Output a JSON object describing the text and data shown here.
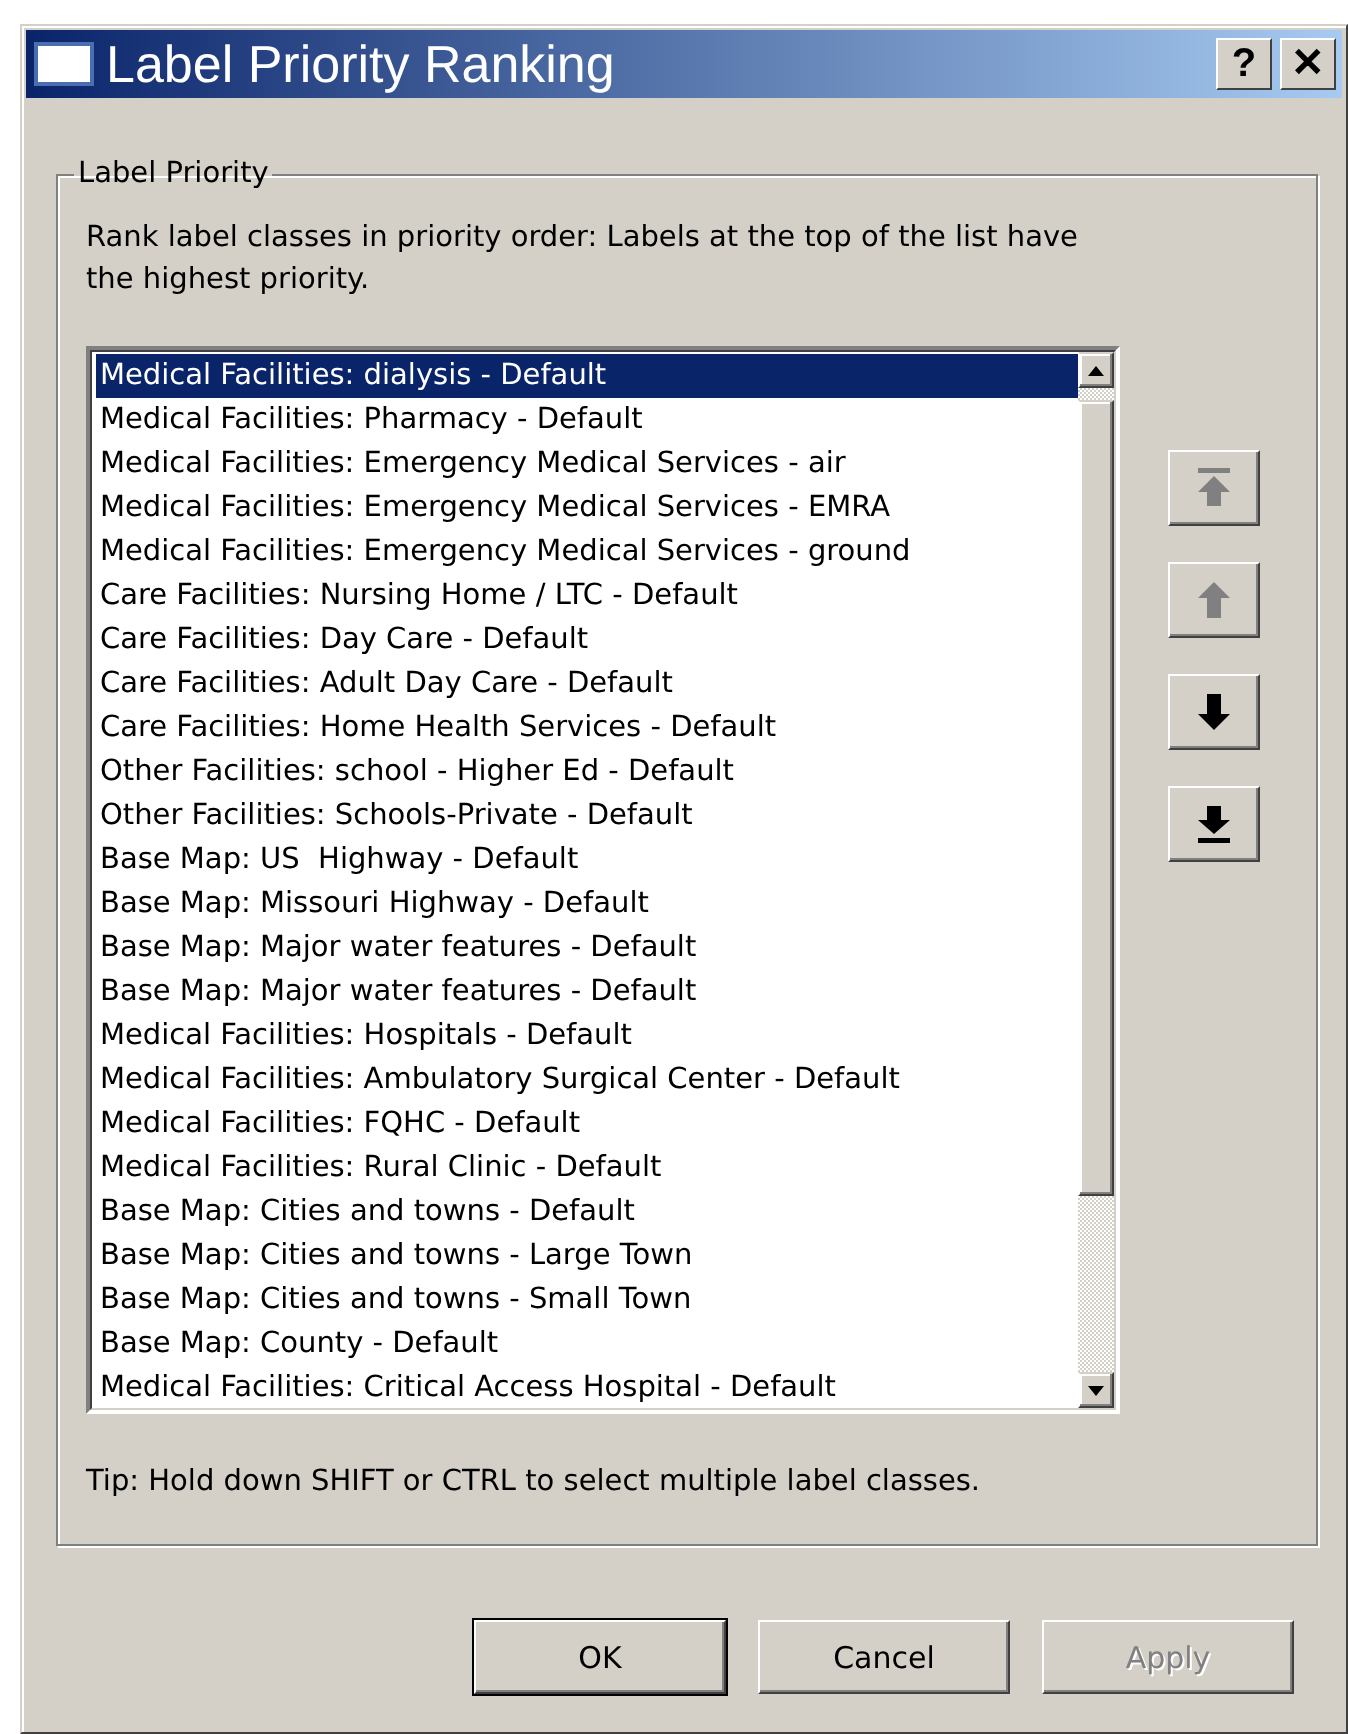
{
  "window": {
    "title": "Label Priority Ranking",
    "title_buttons": [
      "?",
      "✕"
    ]
  },
  "group": {
    "title": "Label Priority",
    "description": "Rank label classes in priority order: Labels at the top of the list have the highest priority.",
    "items": [
      {
        "label": "Medical Facilities: dialysis - Default",
        "selected": true
      },
      {
        "label": "Medical Facilities: Pharmacy - Default",
        "selected": false
      },
      {
        "label": "Medical Facilities: Emergency Medical Services - air",
        "selected": false
      },
      {
        "label": "Medical Facilities: Emergency Medical Services - EMRA",
        "selected": false
      },
      {
        "label": "Medical Facilities: Emergency Medical Services - ground",
        "selected": false
      },
      {
        "label": "Care Facilities: Nursing Home / LTC - Default",
        "selected": false
      },
      {
        "label": "Care Facilities: Day Care - Default",
        "selected": false
      },
      {
        "label": "Care Facilities: Adult Day Care - Default",
        "selected": false
      },
      {
        "label": "Care Facilities: Home Health Services - Default",
        "selected": false
      },
      {
        "label": "Other Facilities: school - Higher Ed - Default",
        "selected": false
      },
      {
        "label": "Other Facilities: Schools-Private - Default",
        "selected": false
      },
      {
        "label": "Base Map: US  Highway - Default",
        "selected": false
      },
      {
        "label": "Base Map: Missouri Highway - Default",
        "selected": false
      },
      {
        "label": "Base Map: Major water features - Default",
        "selected": false
      },
      {
        "label": "Base Map: Major water features - Default",
        "selected": false
      },
      {
        "label": "Medical Facilities: Hospitals - Default",
        "selected": false
      },
      {
        "label": "Medical Facilities: Ambulatory Surgical Center - Default",
        "selected": false
      },
      {
        "label": "Medical Facilities: FQHC - Default",
        "selected": false
      },
      {
        "label": "Medical Facilities: Rural Clinic - Default",
        "selected": false
      },
      {
        "label": "Base Map: Cities and towns - Default",
        "selected": false
      },
      {
        "label": "Base Map: Cities and towns - Large Town",
        "selected": false
      },
      {
        "label": "Base Map: Cities and towns - Small Town",
        "selected": false
      },
      {
        "label": "Base Map: County - Default",
        "selected": false
      },
      {
        "label": "Medical Facilities: Critical Access Hospital - Default",
        "selected": false
      }
    ],
    "move_buttons": [
      {
        "kind": "top",
        "disabled": true
      },
      {
        "kind": "up",
        "disabled": true
      },
      {
        "kind": "down",
        "disabled": false
      },
      {
        "kind": "bottom",
        "disabled": false
      }
    ],
    "tip": "Tip: Hold down SHIFT or CTRL to select multiple label classes."
  },
  "buttons": [
    {
      "label": "OK",
      "default": true,
      "disabled": false
    },
    {
      "label": "Cancel",
      "default": false,
      "disabled": false
    },
    {
      "label": "Apply",
      "default": false,
      "disabled": true
    }
  ]
}
